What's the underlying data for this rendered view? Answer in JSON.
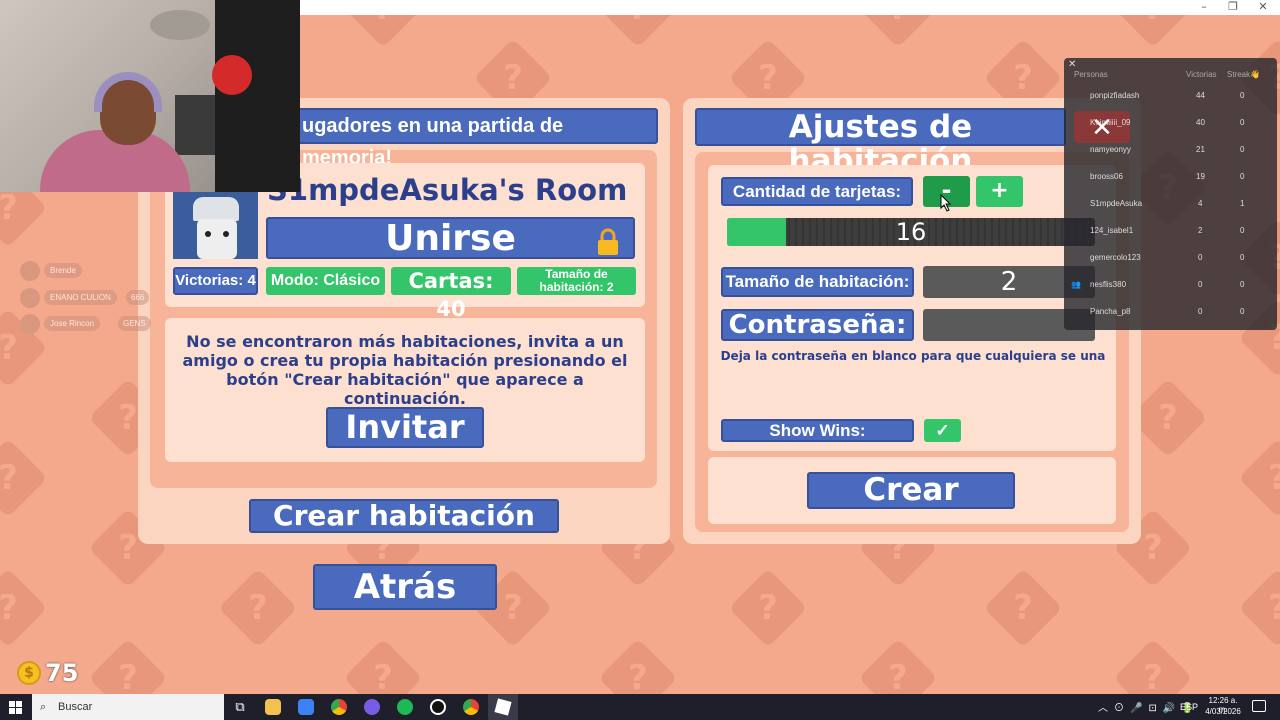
{
  "window_controls": {
    "min": "–",
    "max": "❐",
    "close": "✕"
  },
  "left_panel": {
    "header": "ugadores en una partida de memoria!",
    "room": {
      "title": "S1mpdeAsuka's Room",
      "join_label": "Unirse",
      "lock_icon": "lock-icon",
      "badges": {
        "wins": "Victorias: 4",
        "mode": "Modo: Clásico",
        "cards": "Cartas: 40",
        "size": "Tamaño de habitación: 2"
      }
    },
    "message": "No se encontraron más habitaciones, invita a un amigo o crea tu propia habitación presionando el botón \"Crear habitación\" que aparece a continuación.",
    "invite_label": "Invitar",
    "create_room_label": "Crear habitación"
  },
  "back_label": "Atrás",
  "right_panel": {
    "title": "Ajustes de habitación",
    "cards_label": "Cantidad de tarjetas:",
    "minus": "-",
    "plus": "+",
    "cards_value": "16",
    "cards_fill_fraction": 0.16,
    "size_label": "Tamaño de habitación:",
    "size_value": "2",
    "password_label": "Contraseña:",
    "password_value": "",
    "password_hint": "Deja la contraseña en blanco para que cualquiera se una",
    "show_wins_label": "Show Wins:",
    "show_wins_check": "✓",
    "create_label": "Crear"
  },
  "friends": [
    {
      "name": "Brende",
      "extra": ""
    },
    {
      "name": "ENANO CULION",
      "extra": "666"
    },
    {
      "name": "Jose Rincon",
      "extra": "GENS"
    }
  ],
  "coins": {
    "value": "75",
    "icon": "$"
  },
  "leaderboard": {
    "close": "✕",
    "headers": {
      "people": "Personas",
      "wins": "Victorias",
      "streak": "Streak👋"
    },
    "rows": [
      {
        "name": "ponpizfiadash",
        "wins": "44",
        "streak": "0"
      },
      {
        "name": "Keimiiiii_09",
        "wins": "40",
        "streak": "0"
      },
      {
        "name": "namyeonyy",
        "wins": "21",
        "streak": "0"
      },
      {
        "name": "brooss06",
        "wins": "19",
        "streak": "0"
      },
      {
        "name": "S1mpdeAsuka",
        "wins": "4",
        "streak": "1"
      },
      {
        "name": "124_isabel1",
        "wins": "2",
        "streak": "0"
      },
      {
        "name": "gemercolo123",
        "wins": "0",
        "streak": "0"
      },
      {
        "name": "nesflis380",
        "wins": "0",
        "streak": "0"
      },
      {
        "name": "Pancha_p8",
        "wins": "0",
        "streak": "0"
      }
    ]
  },
  "taskbar": {
    "search_placeholder": "Buscar",
    "lang": "ESP",
    "time": "12:26 a. m.",
    "date": "4/03/2026",
    "colors": {
      "bg": "#1f1f2b"
    }
  }
}
